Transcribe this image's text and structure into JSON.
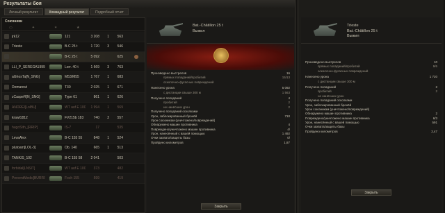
{
  "window": {
    "title": "Результаты боя"
  },
  "tabs": [
    {
      "label": "Личный результат"
    },
    {
      "label": "Командный результат"
    },
    {
      "label": "Подробный отчет"
    }
  ],
  "team": {
    "title": "Союзники"
  },
  "players": [
    {
      "name": "jrk12",
      "tank": "121",
      "damage": "3 208",
      "kills": "1",
      "xp": "563"
    },
    {
      "name": "Trieste",
      "tank": "B-C 25 t",
      "damage": "1 720",
      "kills": "3",
      "xp": "546"
    },
    {
      "name": "",
      "tank": "B-C 25 t",
      "damage": "5 092",
      "kills": "",
      "xp": "625"
    },
    {
      "name": "LLI_P_SEREGA1999..",
      "tank": "Lorr. 40 t",
      "damage": "1 669",
      "kills": "3",
      "xp": "763"
    },
    {
      "name": "aGhosTa[N_SNG]",
      "tank": "M53/M55",
      "damage": "1 767",
      "kills": "1",
      "xp": "683"
    },
    {
      "name": "Demanrut",
      "tank": "T30",
      "damage": "2 025",
      "kills": "1",
      "xp": "671"
    },
    {
      "name": "zCaspeR[N_SNG]",
      "tank": "Type 61",
      "damage": "861",
      "kills": "1",
      "xp": "626"
    },
    {
      "name": "ANDREI[LolBU]",
      "tank": "WT auf E 100",
      "damage": "1 994",
      "kills": "1",
      "xp": "569"
    },
    {
      "name": "krawl1812",
      "tank": "FV215b 183",
      "damage": "740",
      "kills": "2",
      "xp": "557"
    },
    {
      "name": "hugoSith_[RRIP]",
      "tank": "IS-7",
      "damage": "17",
      "kills": "",
      "xp": "535"
    },
    {
      "name": "LevaAlex",
      "tank": "B-C 155 55",
      "damage": "848",
      "kills": "1",
      "xp": "524"
    },
    {
      "name": "plutoam[LOL-3]",
      "tank": "Ob. 140",
      "damage": "665",
      "kills": "1",
      "xp": "513"
    },
    {
      "name": "TANKIS_102",
      "tank": "B-C 155 58",
      "damage": "2 041",
      "kills": "",
      "xp": "503"
    },
    {
      "name": "forbidal[LNSIT]",
      "tank": "WT auf E 100",
      "damage": "373",
      "kills": "",
      "xp": "482"
    },
    {
      "name": "PerventMedic[BURRS]",
      "tank": "Foch 155",
      "damage": "599",
      "kills": "",
      "xp": "419"
    }
  ],
  "selected": {
    "tank_name": "Bat.-Châtillon 25 t",
    "status": "Выжил"
  },
  "stats": [
    {
      "label": "Произведено выстрелов",
      "value": "16",
      "indent": false
    },
    {
      "label": "прямых попаданий/пробитий",
      "value": "15/13",
      "indent": true
    },
    {
      "label": "осколочно-фугасных повреждений",
      "value": "",
      "indent": true
    },
    {
      "label": "Нанесено урона",
      "value": "5 092",
      "indent": false,
      "gap": true
    },
    {
      "label": "с дистанции свыше 300 м",
      "value": "1 563",
      "indent": true
    },
    {
      "label": "Получено попаданий",
      "value": "4",
      "indent": false,
      "gap": true
    },
    {
      "label": "пробитий",
      "value": "2",
      "indent": true
    },
    {
      "label": "не нанёсших урон",
      "value": "2",
      "indent": true
    },
    {
      "label": "Получено попаданий осколками",
      "value": "",
      "indent": false
    },
    {
      "label": "Урон, заблокированный бронёй",
      "value": "710",
      "indent": false
    },
    {
      "label": "Урон союзникам (уничтожено/повреждений)",
      "value": "",
      "indent": false
    },
    {
      "label": "Обнаружено машин противника",
      "value": "4",
      "indent": false
    },
    {
      "label": "Повреждено/уничтожено машин противника",
      "value": "4/",
      "indent": false
    },
    {
      "label": "Урон, нанесённый с вашей помощью",
      "value": "1 492",
      "indent": false
    },
    {
      "label": "Очки захвата/защиты базы",
      "value": "0/",
      "indent": false
    },
    {
      "label": "Пройдено километров",
      "value": "1,87",
      "indent": false
    }
  ],
  "close_label": "Закрыть",
  "second": {
    "player": "Trieste",
    "tank_name": "Bat.-Châtillon 25 t",
    "status": "Выжил",
    "stats": [
      {
        "label": "Произведено выстрелов",
        "value": "10",
        "indent": false
      },
      {
        "label": "прямых попаданий/пробитий",
        "value": "9/6",
        "indent": true
      },
      {
        "label": "осколочно-фугасных повреждений",
        "value": "",
        "indent": true
      },
      {
        "label": "Нанесено урона",
        "value": "1 720",
        "indent": false,
        "gap": true
      },
      {
        "label": "с дистанции свыше 300 м",
        "value": "",
        "indent": true
      },
      {
        "label": "Получено попаданий",
        "value": "2",
        "indent": false,
        "gap": true
      },
      {
        "label": "пробитий",
        "value": "2",
        "indent": true
      },
      {
        "label": "не нанёсших урон",
        "value": "",
        "indent": true
      },
      {
        "label": "Получено попаданий осколками",
        "value": "",
        "indent": false
      },
      {
        "label": "Урон, заблокированный бронёй",
        "value": "",
        "indent": false
      },
      {
        "label": "Урон союзникам (уничтожено/повреждений)",
        "value": "",
        "indent": false
      },
      {
        "label": "Обнаружено машин противника",
        "value": "2",
        "indent": false
      },
      {
        "label": "Повреждено/уничтожено машин противника",
        "value": "6/3",
        "indent": false
      },
      {
        "label": "Урон, нанесённый с вашей помощью",
        "value": "591",
        "indent": false
      },
      {
        "label": "Очки захвата/защиты базы",
        "value": "",
        "indent": false
      },
      {
        "label": "Пройдено километров",
        "value": "2,47",
        "indent": false
      }
    ]
  }
}
